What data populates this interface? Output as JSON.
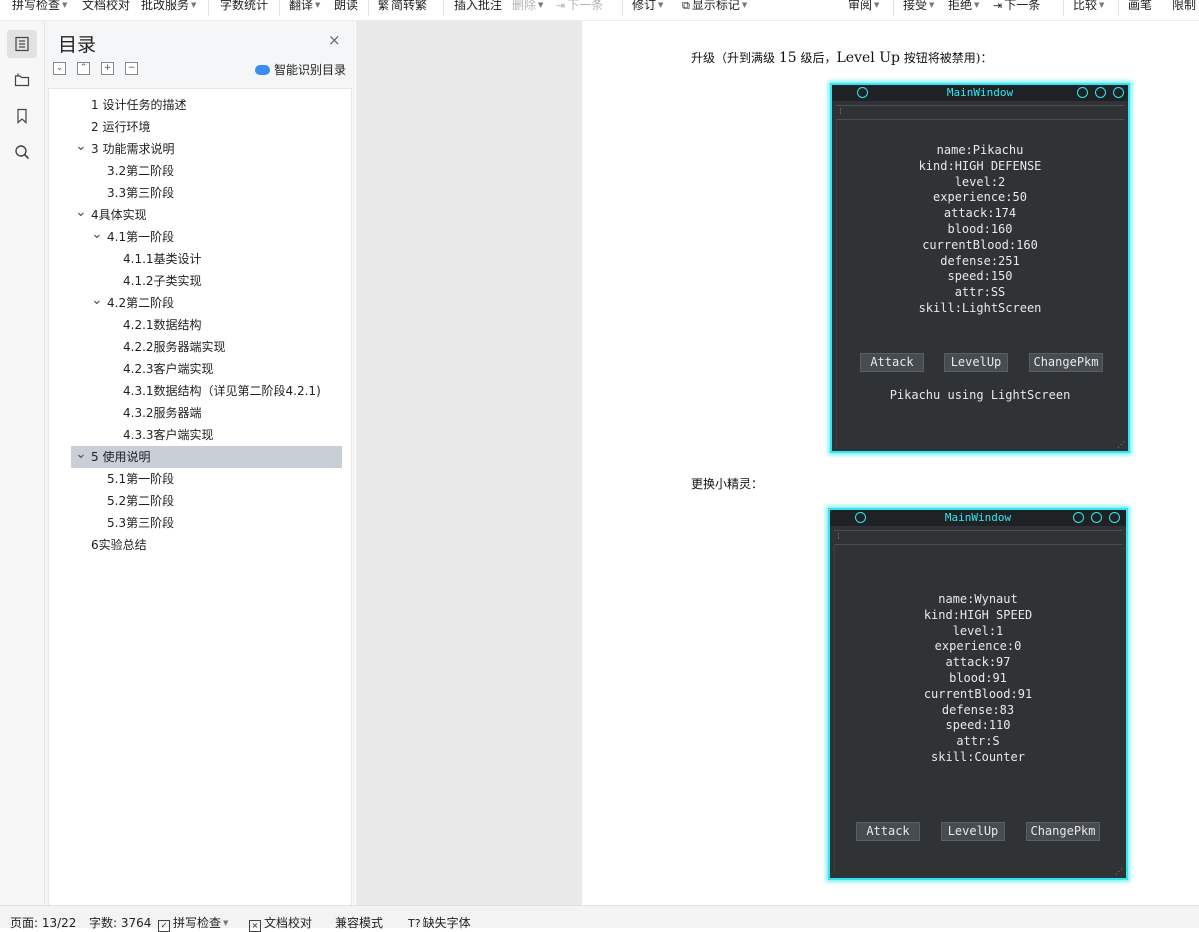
{
  "toolbar": {
    "spell_check": "拼写检查",
    "doc_proof": "文档校对",
    "batch_service": "批改服务",
    "word_count": "字数统计",
    "translate": "翻译",
    "read_aloud": "朗读",
    "simp_trad": "简转繁",
    "insert_comment": "插入批注",
    "delete": "删除",
    "next_comment": "下一条",
    "track_changes": "修订",
    "show_markup": "显示标记",
    "review": "审阅",
    "accept": "接受",
    "reject": "拒绝",
    "next_change": "下一条",
    "compare": "比较",
    "ink": "画笔",
    "restrict": "限制"
  },
  "rail": {
    "icons": [
      "toc-icon",
      "folder-icon",
      "bookmark-icon",
      "search-icon"
    ]
  },
  "toc": {
    "title": "目录",
    "close": "×",
    "smart_label": "智能识别目录",
    "items": [
      {
        "label": "1 设计任务的描述",
        "level": 1,
        "caret": ""
      },
      {
        "label": "2 运行环境",
        "level": 1,
        "caret": ""
      },
      {
        "label": "3 功能需求说明",
        "level": 1,
        "caret": "expanded"
      },
      {
        "label": "3.2第二阶段",
        "level": 2,
        "caret": ""
      },
      {
        "label": "3.3第三阶段",
        "level": 2,
        "caret": ""
      },
      {
        "label": "4具体实现",
        "level": 1,
        "caret": "expanded"
      },
      {
        "label": "4.1第一阶段",
        "level": 2,
        "caret": "expanded"
      },
      {
        "label": "4.1.1基类设计",
        "level": 3,
        "caret": ""
      },
      {
        "label": "4.1.2子类实现",
        "level": 3,
        "caret": ""
      },
      {
        "label": "4.2第二阶段",
        "level": 2,
        "caret": "expanded"
      },
      {
        "label": "4.2.1数据结构",
        "level": 3,
        "caret": ""
      },
      {
        "label": "4.2.2服务器端实现",
        "level": 3,
        "caret": ""
      },
      {
        "label": "4.2.3客户端实现",
        "level": 3,
        "caret": ""
      },
      {
        "label": "4.3.1数据结构（详见第二阶段4.2.1)",
        "level": 3,
        "caret": ""
      },
      {
        "label": "4.3.2服务器端",
        "level": 3,
        "caret": ""
      },
      {
        "label": "4.3.3客户端实现",
        "level": 3,
        "caret": ""
      },
      {
        "label": "5 使用说明",
        "level": 1,
        "caret": "expanded",
        "selected": true
      },
      {
        "label": "5.1第一阶段",
        "level": 2,
        "caret": ""
      },
      {
        "label": "5.2第二阶段",
        "level": 2,
        "caret": ""
      },
      {
        "label": "5.3第三阶段",
        "level": 2,
        "caret": ""
      },
      {
        "label": "6实验总结",
        "level": 1,
        "caret": ""
      }
    ]
  },
  "document": {
    "para1_pre": "升级（升到满级 ",
    "para1_num": "15",
    "para1_mid": " 级后，",
    "para1_en": "Level Up",
    "para1_post": " 按钮将被禁用)：",
    "para2": "更换小精灵："
  },
  "windows": [
    {
      "title": "MainWindow",
      "lines": [
        "name:Pikachu",
        "kind:HIGH DEFENSE",
        "level:2",
        "experience:50",
        "attack:174",
        "blood:160",
        "currentBlood:160",
        "defense:251",
        "speed:150",
        "attr:SS",
        "skill:LightScreen"
      ],
      "buttons": [
        "Attack",
        "LevelUp",
        "ChangePkm"
      ],
      "message": "Pikachu using LightScreen"
    },
    {
      "title": "MainWindow",
      "lines": [
        "name:Wynaut",
        "kind:HIGH SPEED",
        "level:1",
        "experience:0",
        "attack:97",
        "blood:91",
        "currentBlood:91",
        "defense:83",
        "speed:110",
        "attr:S",
        "skill:Counter"
      ],
      "buttons": [
        "Attack",
        "LevelUp",
        "ChangePkm"
      ],
      "message": ""
    }
  ],
  "status": {
    "page": "页面: 13/22",
    "words": "字数: 3764",
    "spell": "拼写检查",
    "proof": "文档校对",
    "compat": "兼容模式",
    "missing_font": "缺失字体"
  },
  "colors": {
    "accent_cyan": "#31e6f0",
    "qt_bg": "#2f3336",
    "toc_selected": "#c8cfd6"
  }
}
